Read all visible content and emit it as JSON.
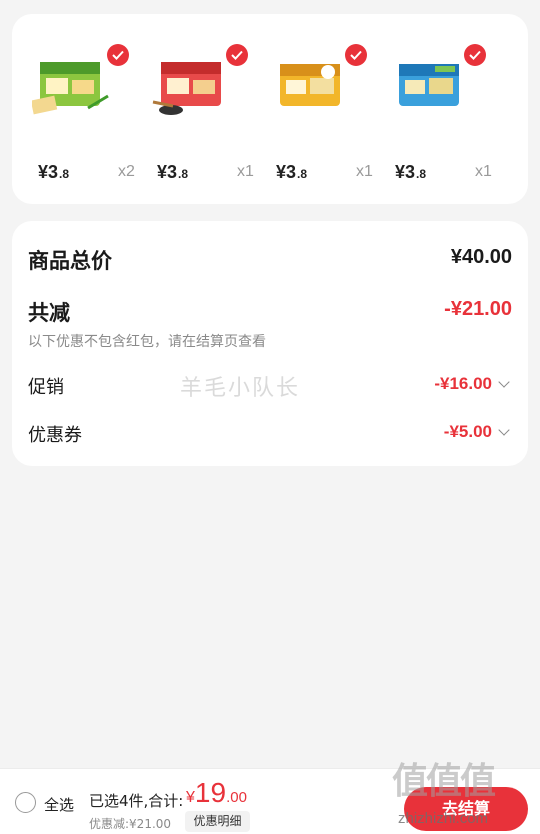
{
  "products": [
    {
      "price_int": "¥3",
      "price_dec": ".8",
      "qty": "x2",
      "pack_color": "#8cc63f",
      "pack_accent": "#4d9a2a",
      "thumb_icon": "cracker-pack-icon"
    },
    {
      "price_int": "¥3",
      "price_dec": ".8",
      "qty": "x1",
      "pack_color": "#e84a4a",
      "pack_accent": "#c42c2c",
      "thumb_icon": "cracker-pack-icon"
    },
    {
      "price_int": "¥3",
      "price_dec": ".8",
      "qty": "x1",
      "pack_color": "#f2b62a",
      "pack_accent": "#d8901a",
      "thumb_icon": "cracker-pack-icon"
    },
    {
      "price_int": "¥3",
      "price_dec": ".8",
      "qty": "x1",
      "pack_color": "#3aa0dc",
      "pack_accent": "#1e78b8",
      "thumb_icon": "cracker-pack-icon"
    }
  ],
  "summary": {
    "total_label": "商品总价",
    "total_value": "¥40.00",
    "reduce_label": "共减",
    "reduce_value": "-¥21.00",
    "note": "以下优惠不包含红包，请在结算页查看",
    "promo_label": "促销",
    "promo_value": "-¥16.00",
    "coupon_label": "优惠券",
    "coupon_value": "-¥5.00"
  },
  "watermark": "羊毛小队长",
  "bottom": {
    "select_all": "全选",
    "selected_count": "已选4件,合计:",
    "total_currency": "¥",
    "total_int": "19",
    "total_dec": ".00",
    "discount_text": "优惠减:¥21.00",
    "detail_button": "优惠明细",
    "checkout_button": "去结算"
  },
  "site_watermark": {
    "logo": "值值值",
    "url": "zhizhizhi.com"
  },
  "colors": {
    "accent": "#e8323a",
    "background": "#f4f4f4"
  }
}
